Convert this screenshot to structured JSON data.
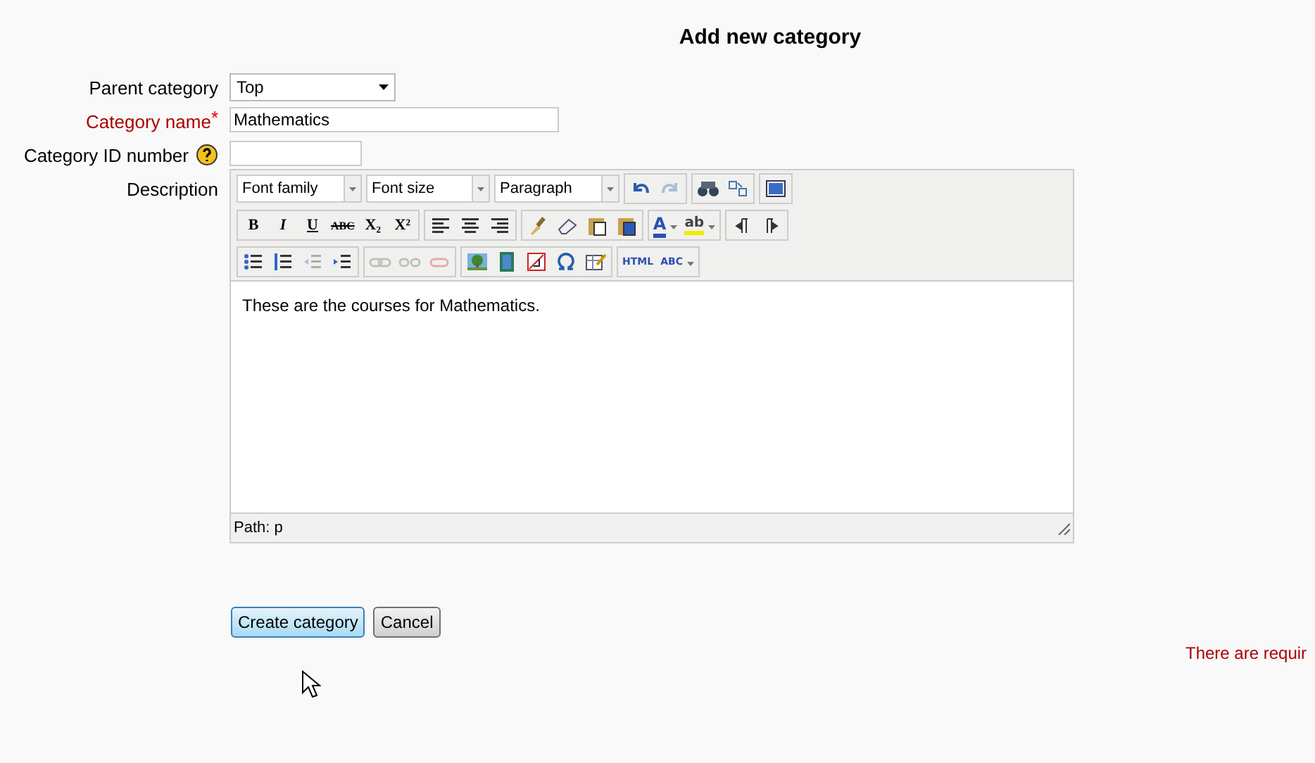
{
  "title": "Add new category",
  "fields": [
    {
      "label": "Parent category",
      "required": false,
      "kind": "select",
      "value": "Top"
    },
    {
      "label": "Category name",
      "required": true,
      "required_mark": "*",
      "kind": "text",
      "value": "Mathematics"
    },
    {
      "label": "Category ID number",
      "required": false,
      "help": true,
      "kind": "text"
    }
  ],
  "description": {
    "label": "Description",
    "selects": [
      "Font family",
      "Font size",
      "Paragraph"
    ],
    "rows": [
      [
        [
          {
            "disabled": false
          },
          {
            "disabled": true
          }
        ],
        [
          {
            "disabled": false
          },
          {
            "disabled": false
          }
        ],
        [
          {
            "disabled": false
          }
        ]
      ],
      [
        [
          {
            "label": "B",
            "disabled": false
          },
          {
            "label": "I",
            "disabled": false
          },
          {
            "label": "U",
            "disabled": false
          },
          {
            "label": "ABC",
            "disabled": false
          },
          {
            "label": "X₂",
            "disabled": false
          },
          {
            "label": "X²",
            "disabled": false
          }
        ],
        [
          {
            "disabled": false
          },
          {
            "disabled": false
          },
          {
            "disabled": false
          }
        ],
        [
          {
            "disabled": false
          },
          {
            "disabled": false
          },
          {
            "disabled": false
          },
          {
            "disabled": false
          }
        ],
        [
          {
            "label": "A",
            "disabled": false
          },
          {
            "label": "ab",
            "disabled": false
          }
        ],
        [
          {
            "disabled": false
          },
          {
            "disabled": false
          }
        ]
      ],
      [
        [
          {
            "disabled": false
          },
          {
            "disabled": false
          },
          {
            "disabled": true
          },
          {
            "disabled": false
          }
        ],
        [
          {
            "disabled": true
          },
          {
            "disabled": true
          },
          {
            "disabled": true
          }
        ],
        [
          {
            "disabled": false
          },
          {
            "disabled": false
          },
          {
            "disabled": false
          },
          {
            "disabled": false
          },
          {
            "disabled": false
          }
        ],
        [
          {
            "label": "HTML",
            "disabled": false
          },
          {
            "label": "ABC",
            "disabled": false
          }
        ]
      ]
    ],
    "content": "These are the courses for Mathematics.",
    "path": "Path: p"
  },
  "buttons": [
    {
      "label": "Create category",
      "hovered": true
    },
    {
      "label": "Cancel",
      "hovered": false
    }
  ],
  "error": "There are requir"
}
